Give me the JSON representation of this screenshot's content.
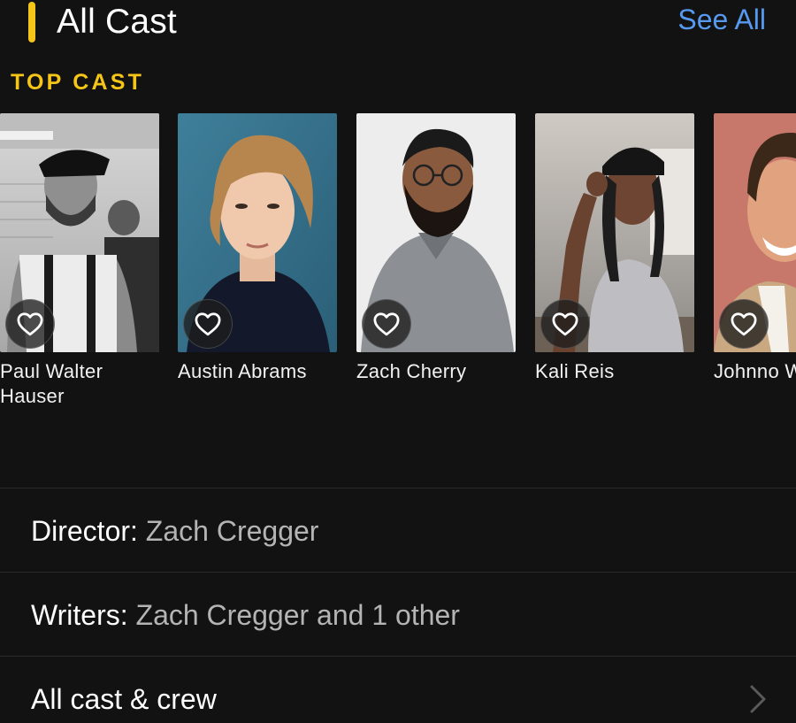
{
  "header": {
    "title": "All Cast",
    "see_all": "See All",
    "subheader": "TOP CAST",
    "accent_color": "#f5c518",
    "link_color": "#5799ef"
  },
  "cast": [
    {
      "name": "Paul Walter Hauser",
      "icon": "heart-icon"
    },
    {
      "name": "Austin Abrams",
      "icon": "heart-icon"
    },
    {
      "name": "Zach Cherry",
      "icon": "heart-icon"
    },
    {
      "name": "Kali Reis",
      "icon": "heart-icon"
    },
    {
      "name": "Johnno Wilson",
      "icon": "heart-icon"
    }
  ],
  "crew": {
    "director_label": "Director:",
    "director_value": "Zach Cregger",
    "writers_label": "Writers:",
    "writers_value": "Zach Cregger and 1 other",
    "all_cast_crew": "All cast & crew",
    "chevron_icon": "chevron-right-icon"
  }
}
